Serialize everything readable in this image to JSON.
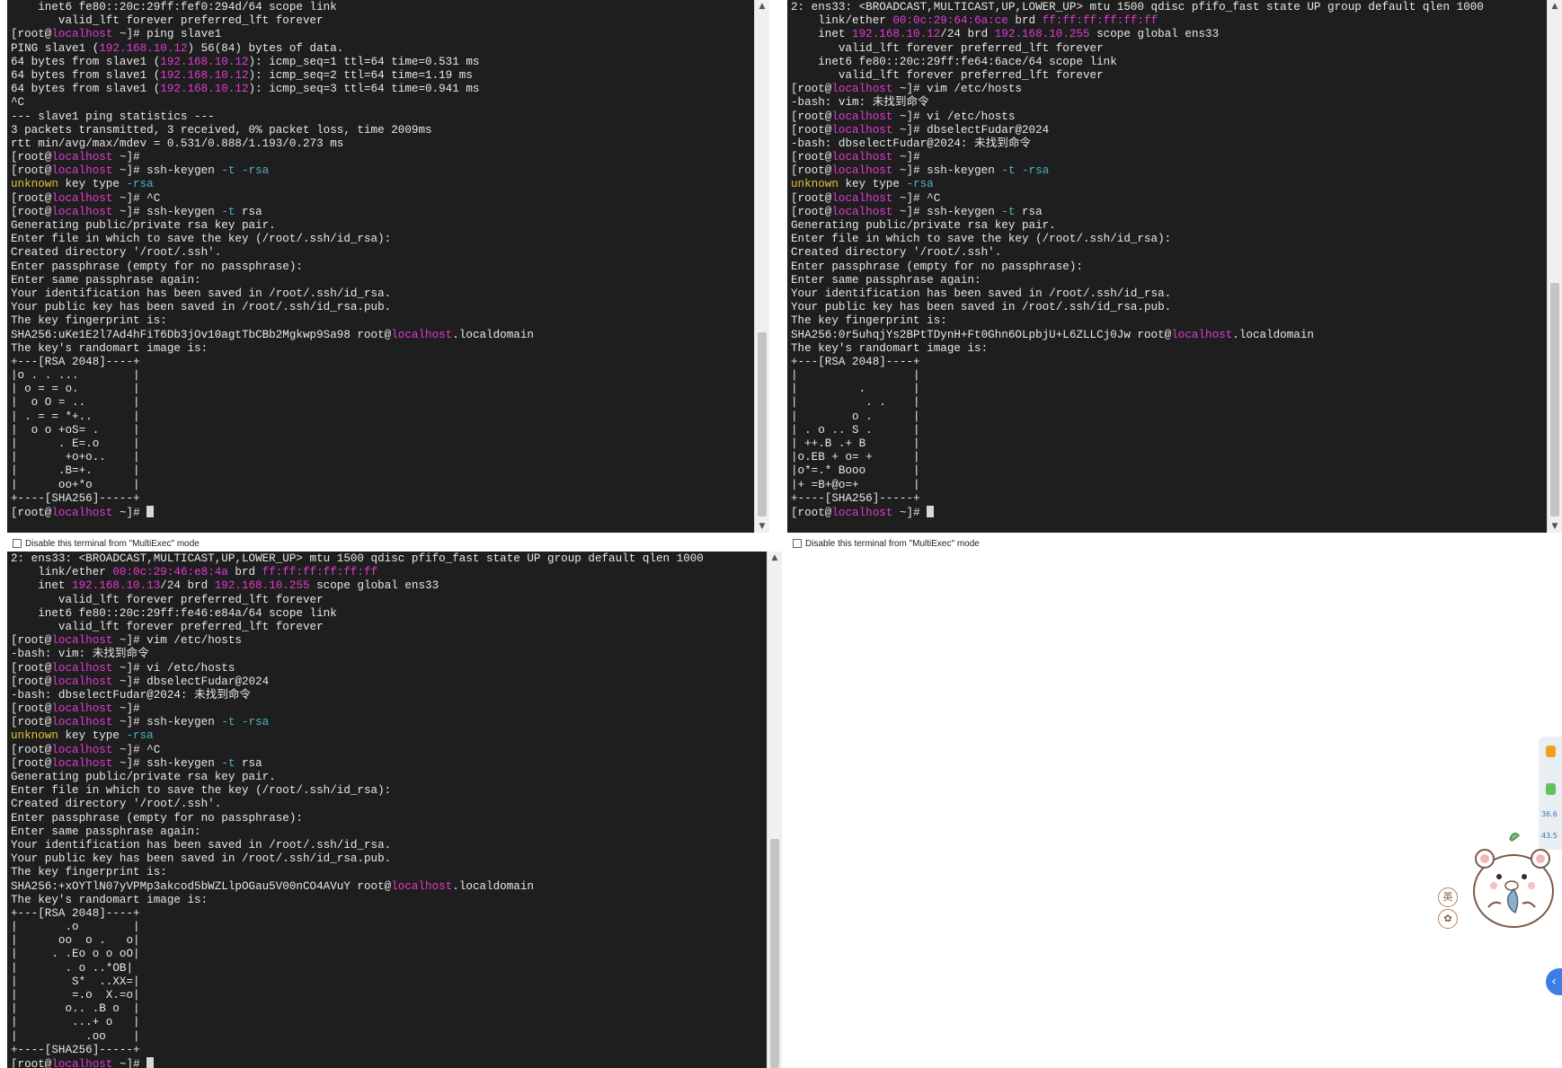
{
  "multiexec": {
    "label": "Disable this terminal from \"MultiExec\" mode"
  },
  "terminals": [
    {
      "lines": [
        [
          [
            "    inet6 fe80::20c:29ff:fef0:294d/64 scope link",
            ""
          ]
        ],
        [
          [
            "       valid_lft forever preferred_lft forever",
            ""
          ]
        ],
        [
          [
            "[root@",
            ""
          ],
          [
            "localhost",
            "host"
          ],
          [
            " ~]# ping slave1",
            ""
          ]
        ],
        [
          [
            "PING slave1 (",
            ""
          ],
          [
            "192.168.10.12",
            "ip"
          ],
          [
            ") 56(84) bytes of data.",
            ""
          ]
        ],
        [
          [
            "64 bytes from slave1 (",
            ""
          ],
          [
            "192.168.10.12",
            "ip"
          ],
          [
            "): icmp_seq=1 ttl=64 time=0.531 ms",
            ""
          ]
        ],
        [
          [
            "64 bytes from slave1 (",
            ""
          ],
          [
            "192.168.10.12",
            "ip"
          ],
          [
            "): icmp_seq=2 ttl=64 time=1.19 ms",
            ""
          ]
        ],
        [
          [
            "64 bytes from slave1 (",
            ""
          ],
          [
            "192.168.10.12",
            "ip"
          ],
          [
            "): icmp_seq=3 ttl=64 time=0.941 ms",
            ""
          ]
        ],
        [
          [
            "^C",
            ""
          ]
        ],
        [
          [
            "--- slave1 ping statistics ---",
            ""
          ]
        ],
        [
          [
            "3 packets transmitted, 3 received, 0% packet loss, time 2009ms",
            ""
          ]
        ],
        [
          [
            "rtt min/avg/max/mdev = 0.531/0.888/1.193/0.273 ms",
            ""
          ]
        ],
        [
          [
            "[root@",
            ""
          ],
          [
            "localhost",
            "host"
          ],
          [
            " ~]#",
            ""
          ]
        ],
        [
          [
            "[root@",
            ""
          ],
          [
            "localhost",
            "host"
          ],
          [
            " ~]# ssh-keygen ",
            ""
          ],
          [
            "-t -rsa",
            "opt"
          ]
        ],
        [
          [
            "unknown",
            "warn"
          ],
          [
            " key type ",
            ""
          ],
          [
            "-rsa",
            "opt"
          ]
        ],
        [
          [
            "[root@",
            ""
          ],
          [
            "localhost",
            "host"
          ],
          [
            " ~]# ^C",
            ""
          ]
        ],
        [
          [
            "[root@",
            ""
          ],
          [
            "localhost",
            "host"
          ],
          [
            " ~]# ssh-keygen ",
            ""
          ],
          [
            "-t",
            "opt"
          ],
          [
            " rsa",
            ""
          ]
        ],
        [
          [
            "Generating public/private rsa key pair.",
            ""
          ]
        ],
        [
          [
            "Enter file in which to save the key (/root/.ssh/id_rsa):",
            ""
          ]
        ],
        [
          [
            "Created directory '/root/.ssh'.",
            ""
          ]
        ],
        [
          [
            "Enter passphrase (empty for no passphrase):",
            ""
          ]
        ],
        [
          [
            "Enter same passphrase again:",
            ""
          ]
        ],
        [
          [
            "Your identification has been saved in /root/.ssh/id_rsa.",
            ""
          ]
        ],
        [
          [
            "Your public key has been saved in /root/.ssh/id_rsa.pub.",
            ""
          ]
        ],
        [
          [
            "The key fingerprint is:",
            ""
          ]
        ],
        [
          [
            "SHA256:uKe1E2l7Ad4hFiT6Db3jOv10agtTbCBb2Mgkwp9Sa98 root@",
            ""
          ],
          [
            "localhost",
            "host"
          ],
          [
            ".localdomain",
            ""
          ]
        ],
        [
          [
            "The key's randomart image is:",
            ""
          ]
        ],
        [
          [
            "+---[RSA 2048]----+",
            ""
          ]
        ],
        [
          [
            "|o . . ...        |",
            ""
          ]
        ],
        [
          [
            "| o = = o.        |",
            ""
          ]
        ],
        [
          [
            "|  o O = ..       |",
            ""
          ]
        ],
        [
          [
            "| . = = *+..      |",
            ""
          ]
        ],
        [
          [
            "|  o o +oS= .     |",
            ""
          ]
        ],
        [
          [
            "|      . E=.o     |",
            ""
          ]
        ],
        [
          [
            "|       +o+o..    |",
            ""
          ]
        ],
        [
          [
            "|      .B=+.      |",
            ""
          ]
        ],
        [
          [
            "|      oo+*o      |",
            ""
          ]
        ],
        [
          [
            "+----[SHA256]-----+",
            ""
          ]
        ],
        [
          [
            "[root@",
            ""
          ],
          [
            "localhost",
            "host"
          ],
          [
            " ~]# ",
            ""
          ]
        ]
      ]
    },
    {
      "lines": [
        [
          [
            "2: ens33: <BROADCAST,MULTICAST,UP,LOWER_UP> mtu 1500 qdisc pfifo_fast state UP group default qlen 1000",
            ""
          ]
        ],
        [
          [
            "    link/ether ",
            ""
          ],
          [
            "00:0c:29:64:6a:ce",
            "mac"
          ],
          [
            " brd ",
            ""
          ],
          [
            "ff:ff:ff:ff:ff:ff",
            "mac"
          ]
        ],
        [
          [
            "    inet ",
            ""
          ],
          [
            "192.168.10.12",
            "ip"
          ],
          [
            "/24 brd ",
            ""
          ],
          [
            "192.168.10.255",
            "ip"
          ],
          [
            " scope global ens33",
            ""
          ]
        ],
        [
          [
            "       valid_lft forever preferred_lft forever",
            ""
          ]
        ],
        [
          [
            "    inet6 fe80::20c:29ff:fe64:6ace/64 scope link",
            ""
          ]
        ],
        [
          [
            "       valid_lft forever preferred_lft forever",
            ""
          ]
        ],
        [
          [
            "[root@",
            ""
          ],
          [
            "localhost",
            "host"
          ],
          [
            " ~]# vim /etc/hosts",
            ""
          ]
        ],
        [
          [
            "-bash: vim: 未找到命令",
            ""
          ]
        ],
        [
          [
            "[root@",
            ""
          ],
          [
            "localhost",
            "host"
          ],
          [
            " ~]# vi /etc/hosts",
            ""
          ]
        ],
        [
          [
            "[root@",
            ""
          ],
          [
            "localhost",
            "host"
          ],
          [
            " ~]# dbselectFudar@2024",
            ""
          ]
        ],
        [
          [
            "-bash: dbselectFudar@2024: 未找到命令",
            ""
          ]
        ],
        [
          [
            "[root@",
            ""
          ],
          [
            "localhost",
            "host"
          ],
          [
            " ~]#",
            ""
          ]
        ],
        [
          [
            "[root@",
            ""
          ],
          [
            "localhost",
            "host"
          ],
          [
            " ~]# ssh-keygen ",
            ""
          ],
          [
            "-t -rsa",
            "opt"
          ]
        ],
        [
          [
            "unknown",
            "warn"
          ],
          [
            " key type ",
            ""
          ],
          [
            "-rsa",
            "opt"
          ]
        ],
        [
          [
            "[root@",
            ""
          ],
          [
            "localhost",
            "host"
          ],
          [
            " ~]# ^C",
            ""
          ]
        ],
        [
          [
            "[root@",
            ""
          ],
          [
            "localhost",
            "host"
          ],
          [
            " ~]# ssh-keygen ",
            ""
          ],
          [
            "-t",
            "opt"
          ],
          [
            " rsa",
            ""
          ]
        ],
        [
          [
            "Generating public/private rsa key pair.",
            ""
          ]
        ],
        [
          [
            "Enter file in which to save the key (/root/.ssh/id_rsa):",
            ""
          ]
        ],
        [
          [
            "Created directory '/root/.ssh'.",
            ""
          ]
        ],
        [
          [
            "Enter passphrase (empty for no passphrase):",
            ""
          ]
        ],
        [
          [
            "Enter same passphrase again:",
            ""
          ]
        ],
        [
          [
            "Your identification has been saved in /root/.ssh/id_rsa.",
            ""
          ]
        ],
        [
          [
            "Your public key has been saved in /root/.ssh/id_rsa.pub.",
            ""
          ]
        ],
        [
          [
            "The key fingerprint is:",
            ""
          ]
        ],
        [
          [
            "SHA256:0r5uhqjYs2BPtTDynH+Ft0Ghn6OLpbjU+L6ZLLCj0Jw root@",
            ""
          ],
          [
            "localhost",
            "host"
          ],
          [
            ".localdomain",
            ""
          ]
        ],
        [
          [
            "The key's randomart image is:",
            ""
          ]
        ],
        [
          [
            "+---[RSA 2048]----+",
            ""
          ]
        ],
        [
          [
            "|                 |",
            ""
          ]
        ],
        [
          [
            "|         .       |",
            ""
          ]
        ],
        [
          [
            "|          . .    |",
            ""
          ]
        ],
        [
          [
            "|        o .      |",
            ""
          ]
        ],
        [
          [
            "| . o .. S .      |",
            ""
          ]
        ],
        [
          [
            "| ++.B .+ B       |",
            ""
          ]
        ],
        [
          [
            "|o.EB + o= +      |",
            ""
          ]
        ],
        [
          [
            "|o*=.* Booo       |",
            ""
          ]
        ],
        [
          [
            "|+ =B+@o=+        |",
            ""
          ]
        ],
        [
          [
            "+----[SHA256]-----+",
            ""
          ]
        ],
        [
          [
            "[root@",
            ""
          ],
          [
            "localhost",
            "host"
          ],
          [
            " ~]# ",
            ""
          ]
        ]
      ]
    },
    {
      "lines": [
        [
          [
            "2: ens33: <BROADCAST,MULTICAST,UP,LOWER_UP> mtu 1500 qdisc pfifo_fast state UP group default qlen 1000",
            ""
          ]
        ],
        [
          [
            "    link/ether ",
            ""
          ],
          [
            "00:0c:29:46:e8:4a",
            "mac"
          ],
          [
            " brd ",
            ""
          ],
          [
            "ff:ff:ff:ff:ff:ff",
            "mac"
          ]
        ],
        [
          [
            "    inet ",
            ""
          ],
          [
            "192.168.10.13",
            "ip"
          ],
          [
            "/24 brd ",
            ""
          ],
          [
            "192.168.10.255",
            "ip"
          ],
          [
            " scope global ens33",
            ""
          ]
        ],
        [
          [
            "       valid_lft forever preferred_lft forever",
            ""
          ]
        ],
        [
          [
            "    inet6 fe80::20c:29ff:fe46:e84a/64 scope link",
            ""
          ]
        ],
        [
          [
            "       valid_lft forever preferred_lft forever",
            ""
          ]
        ],
        [
          [
            "[root@",
            ""
          ],
          [
            "localhost",
            "host"
          ],
          [
            " ~]# vim /etc/hosts",
            ""
          ]
        ],
        [
          [
            "-bash: vim: 未找到命令",
            ""
          ]
        ],
        [
          [
            "[root@",
            ""
          ],
          [
            "localhost",
            "host"
          ],
          [
            " ~]# vi /etc/hosts",
            ""
          ]
        ],
        [
          [
            "[root@",
            ""
          ],
          [
            "localhost",
            "host"
          ],
          [
            " ~]# dbselectFudar@2024",
            ""
          ]
        ],
        [
          [
            "-bash: dbselectFudar@2024: 未找到命令",
            ""
          ]
        ],
        [
          [
            "[root@",
            ""
          ],
          [
            "localhost",
            "host"
          ],
          [
            " ~]#",
            ""
          ]
        ],
        [
          [
            "[root@",
            ""
          ],
          [
            "localhost",
            "host"
          ],
          [
            " ~]# ssh-keygen ",
            ""
          ],
          [
            "-t -rsa",
            "opt"
          ]
        ],
        [
          [
            "unknown",
            "warn"
          ],
          [
            " key type ",
            ""
          ],
          [
            "-rsa",
            "opt"
          ]
        ],
        [
          [
            "[root@",
            ""
          ],
          [
            "localhost",
            "host"
          ],
          [
            " ~]# ^C",
            ""
          ]
        ],
        [
          [
            "[root@",
            ""
          ],
          [
            "localhost",
            "host"
          ],
          [
            " ~]# ssh-keygen ",
            ""
          ],
          [
            "-t",
            "opt"
          ],
          [
            " rsa",
            ""
          ]
        ],
        [
          [
            "Generating public/private rsa key pair.",
            ""
          ]
        ],
        [
          [
            "Enter file in which to save the key (/root/.ssh/id_rsa):",
            ""
          ]
        ],
        [
          [
            "Created directory '/root/.ssh'.",
            ""
          ]
        ],
        [
          [
            "Enter passphrase (empty for no passphrase):",
            ""
          ]
        ],
        [
          [
            "Enter same passphrase again:",
            ""
          ]
        ],
        [
          [
            "Your identification has been saved in /root/.ssh/id_rsa.",
            ""
          ]
        ],
        [
          [
            "Your public key has been saved in /root/.ssh/id_rsa.pub.",
            ""
          ]
        ],
        [
          [
            "The key fingerprint is:",
            ""
          ]
        ],
        [
          [
            "SHA256:+xOYTlN07yVPMp3akcod5bWZLlpOGau5V00nCO4AVuY root@",
            ""
          ],
          [
            "localhost",
            "host"
          ],
          [
            ".localdomain",
            ""
          ]
        ],
        [
          [
            "The key's randomart image is:",
            ""
          ]
        ],
        [
          [
            "+---[RSA 2048]----+",
            ""
          ]
        ],
        [
          [
            "|       .o        |",
            ""
          ]
        ],
        [
          [
            "|      oo  o .   o|",
            ""
          ]
        ],
        [
          [
            "|     . .Eo o o oO|",
            ""
          ]
        ],
        [
          [
            "|       . o ..*OB|",
            ""
          ]
        ],
        [
          [
            "|        S*  ..XX=|",
            ""
          ]
        ],
        [
          [
            "|        =.o  X.=o|",
            ""
          ]
        ],
        [
          [
            "|       o.. .B o  |",
            ""
          ]
        ],
        [
          [
            "|        ...+ o   |",
            ""
          ]
        ],
        [
          [
            "|          .oo    |",
            ""
          ]
        ],
        [
          [
            "+----[SHA256]-----+",
            ""
          ]
        ],
        [
          [
            "[root@",
            ""
          ],
          [
            "localhost",
            "host"
          ],
          [
            " ~]# ",
            ""
          ]
        ]
      ]
    }
  ],
  "widgets": {
    "net_up": "36.6",
    "net_down": "43.5",
    "ime_label_1": "英",
    "ime_label_2": "✿"
  }
}
